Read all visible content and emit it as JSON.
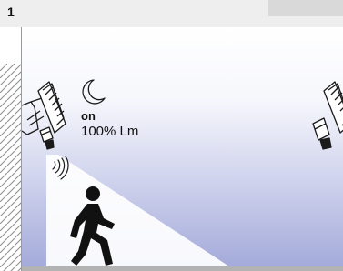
{
  "panel": {
    "number": "1"
  },
  "status": {
    "state": "on",
    "output": "100% Lm"
  },
  "icons": [
    "moon-icon",
    "motion-sensor-waves-icon",
    "walking-person-icon",
    "floodlight-icon"
  ],
  "colors": {
    "background_top": "#ffffff",
    "background_bottom": "#a2a8d9",
    "light_beam": "#ffffff",
    "wall_hatch": "#8a8a8a",
    "fixture_stroke": "#1a1a1a"
  }
}
